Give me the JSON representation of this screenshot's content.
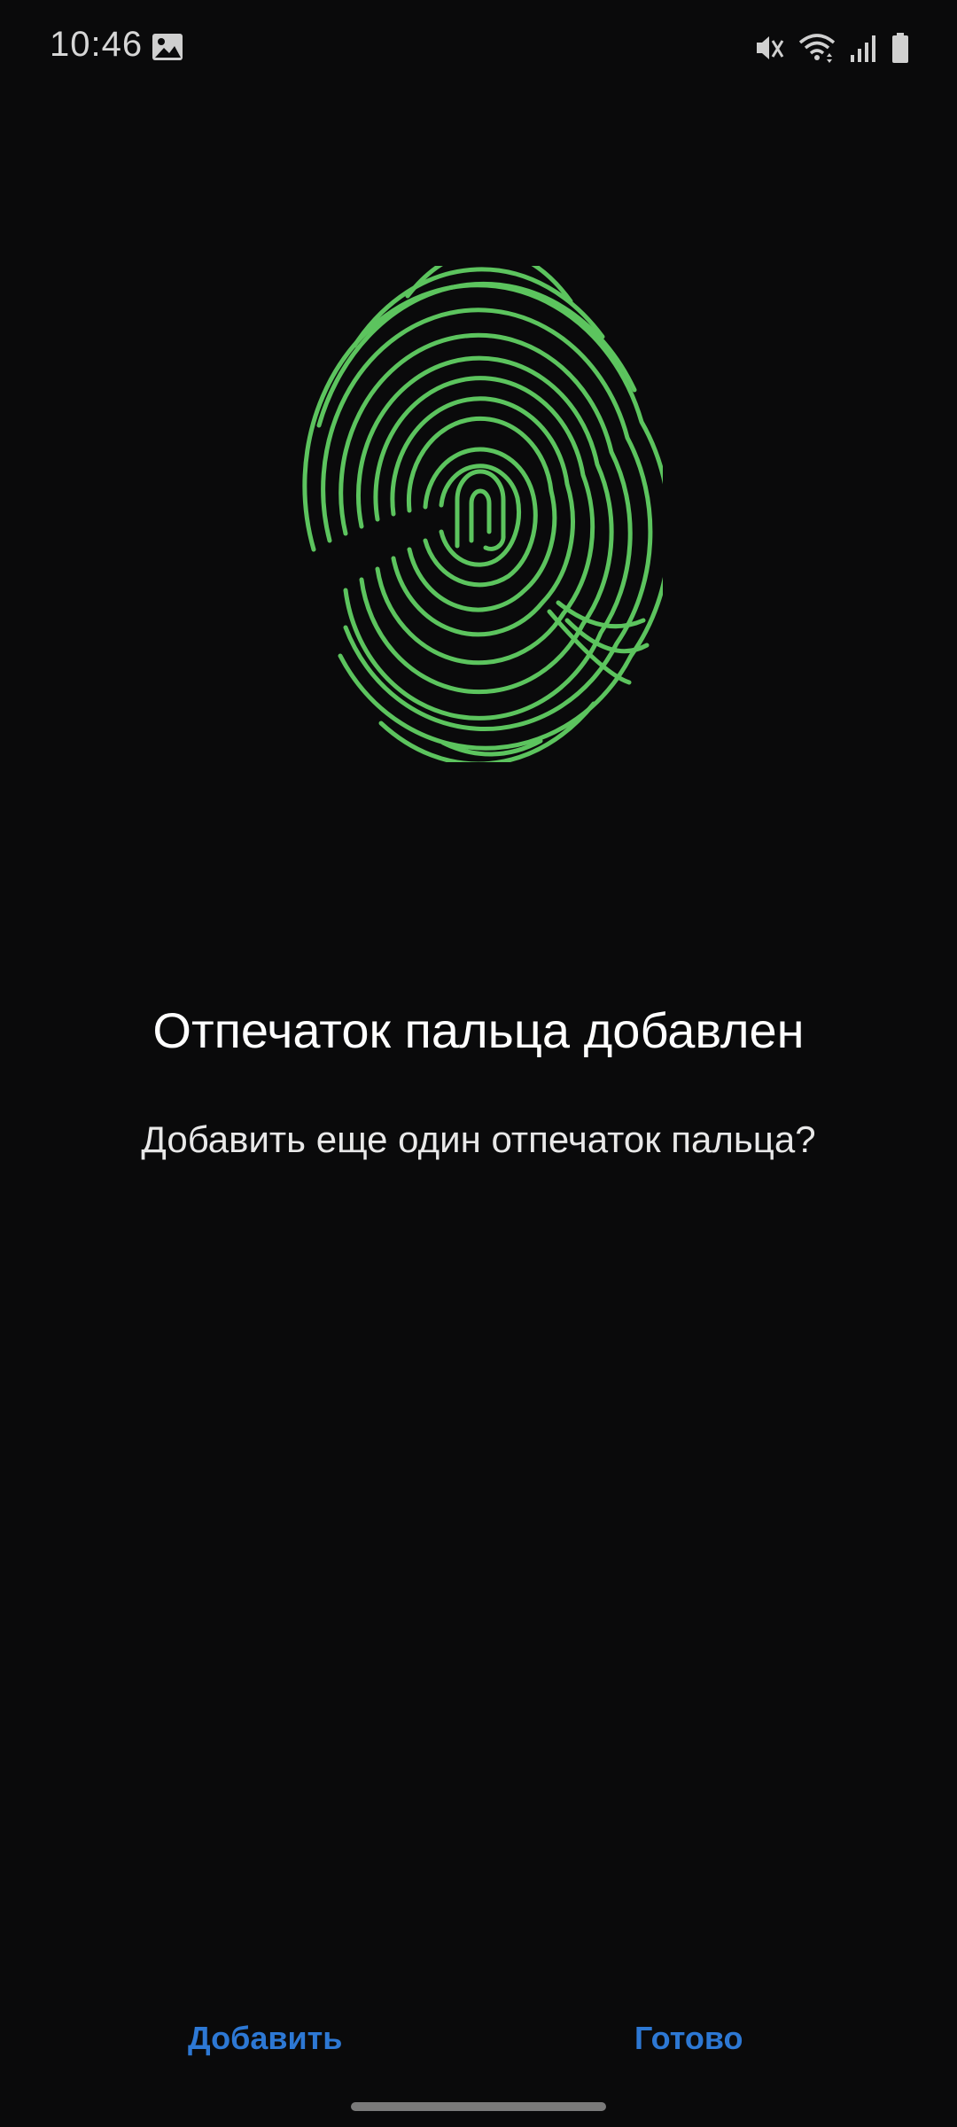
{
  "status_bar": {
    "time": "10:46",
    "left_icons": [
      "image-icon"
    ],
    "right_icons": [
      "mute-vibrate-icon",
      "wifi-icon",
      "signal-icon",
      "battery-icon"
    ]
  },
  "illustration": {
    "icon": "fingerprint-icon",
    "color": "#5cc45e"
  },
  "content": {
    "title": "Отпечаток пальца добавлен",
    "subtitle": "Добавить еще один отпечаток пальца?"
  },
  "actions": {
    "add_label": "Добавить",
    "done_label": "Готово",
    "accent_color": "#2d78d4"
  }
}
